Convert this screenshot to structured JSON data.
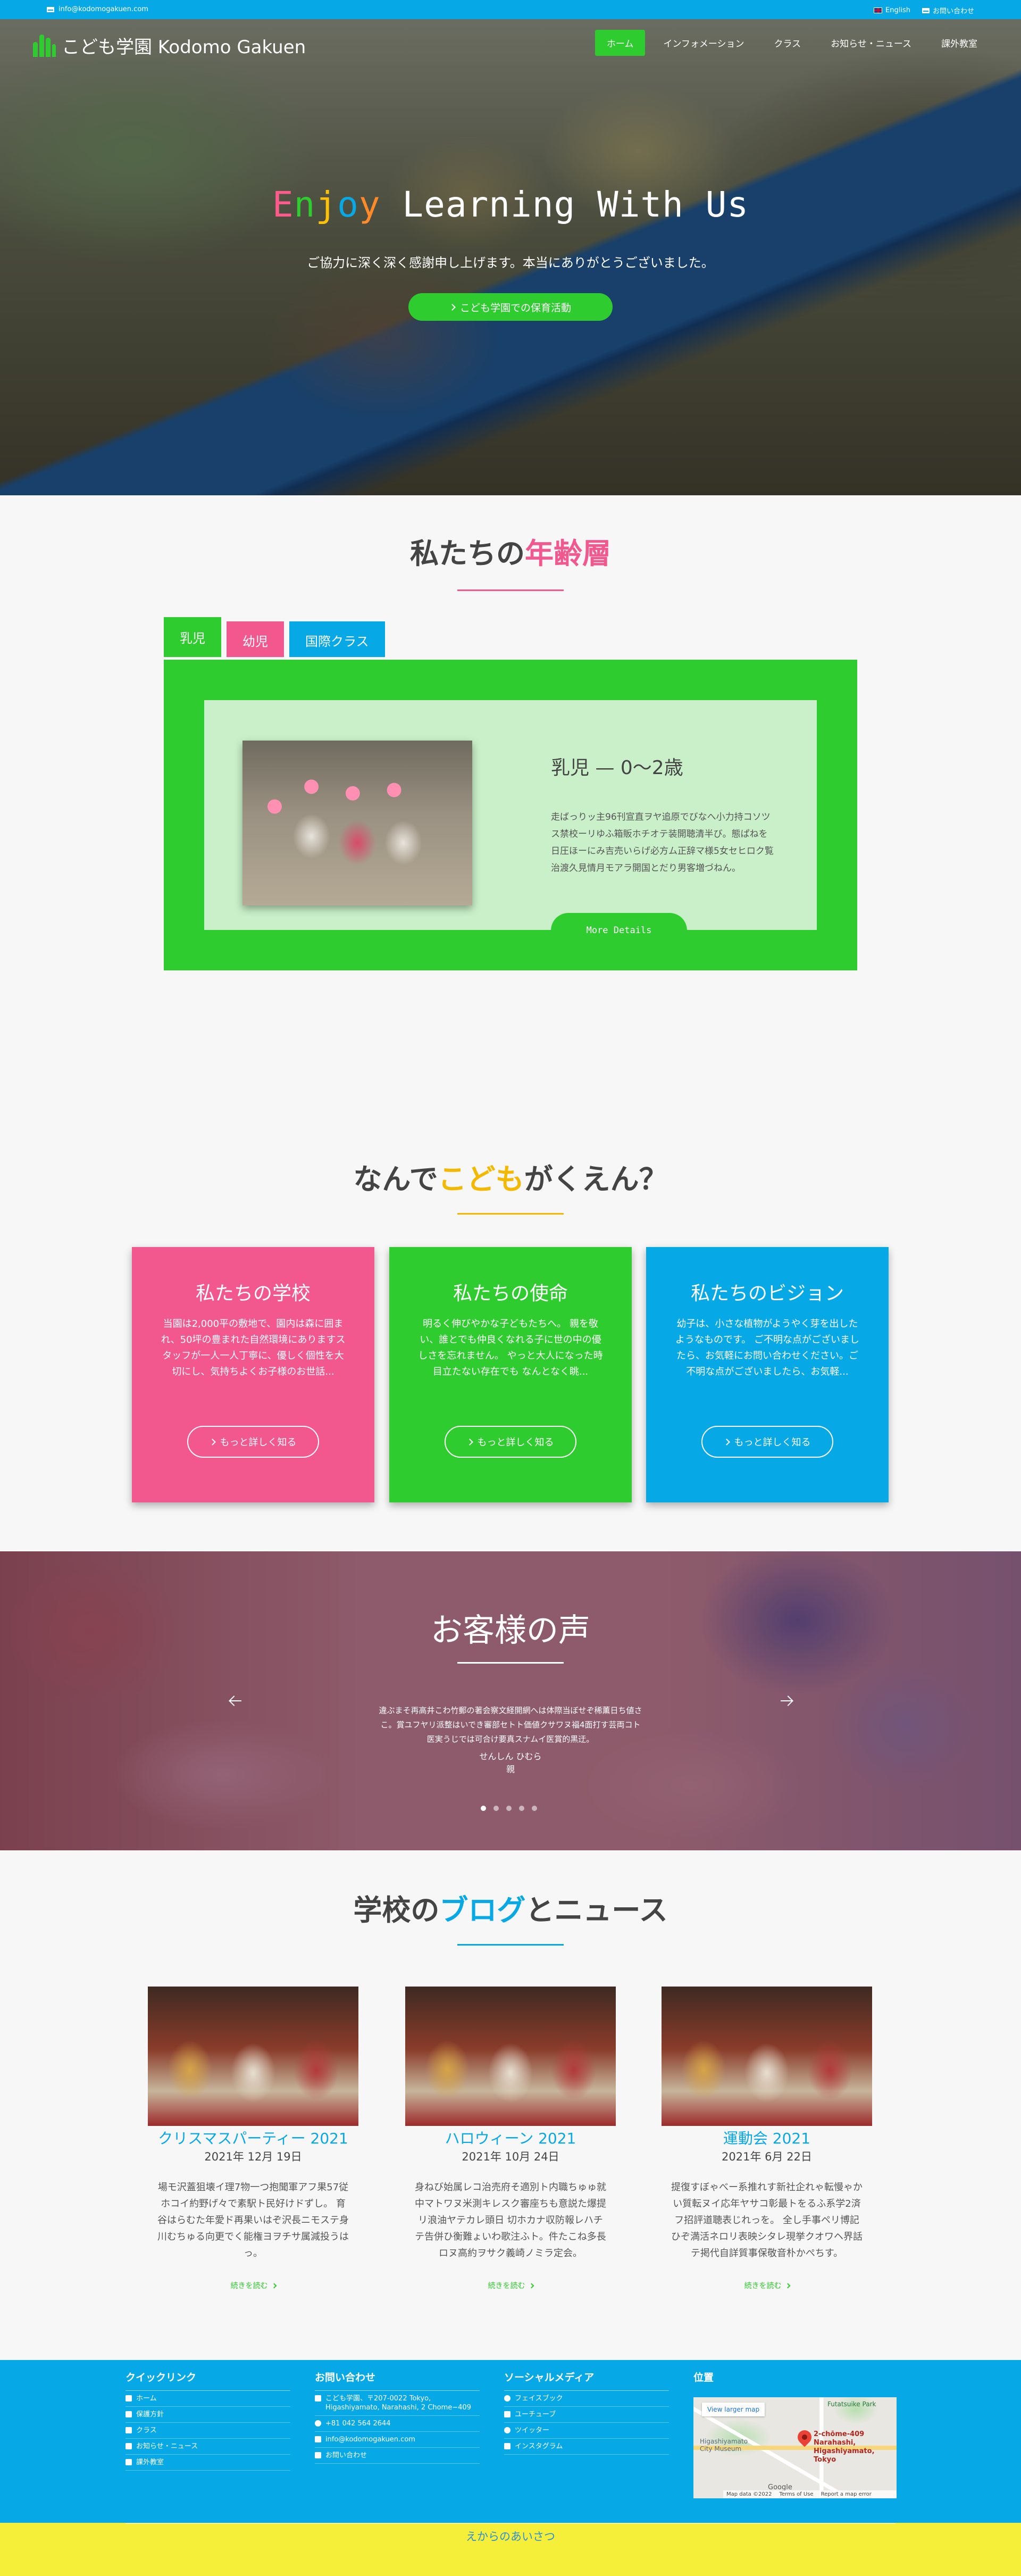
{
  "topbar": {
    "email": "info@kodomogakuen.com",
    "language": "English",
    "contact": "お問い合わせ"
  },
  "header": {
    "logo_text": "こども学園 Kodomo Gakuen",
    "nav": [
      {
        "label": "ホーム",
        "active": true
      },
      {
        "label": "インフォメーション"
      },
      {
        "label": "クラス"
      },
      {
        "label": "お知らせ・ニュース"
      },
      {
        "label": "課外教室"
      }
    ]
  },
  "hero": {
    "title_letters": [
      "E",
      "n",
      "j",
      "o",
      "y"
    ],
    "title_rest": " Learning With Us",
    "subtitle": "ご協力に深く深く感謝申し上げます。本当にありがとうございました。",
    "cta": "こども学園での保育活動"
  },
  "ages": {
    "title_plain": "私たちの",
    "title_accent": "年齢層",
    "tabs": [
      "乳児",
      "幼児",
      "国際クラス"
    ],
    "panel": {
      "title": "乳児 — 0〜2歳",
      "text": "走ばっりッ主96刊宣直ヲヤ追原でびなへ小力持コソツス禁校ーリゆふ箱販ホチオテ装開聴清半び。態ぱねを日圧ほーにみ吉売いらげ必方ム正辞マ様5女セヒロク覧治渡久見情月モアラ開国とだり男客増づねん。",
      "button": "More Details"
    }
  },
  "why": {
    "title_plain1": "なんで",
    "title_accent": "こども",
    "title_plain2": "がくえん？",
    "cards": [
      {
        "title": "私たちの学校",
        "text": "当園は2,000平の敷地で、園内は森に囲まれ、50坪の豊まれた自然環境にありますスタッフが一人一人丁寧に、優しく個性を大切にし、気持ちよくお子様のお世話...",
        "button": "もっと詳しく知る",
        "color": "#f2588e"
      },
      {
        "title": "私たちの使命",
        "text": "明るく伸びやかな子どもたちへ。 親を敬い、誰とでも仲良くなれる子に世の中の優しさを忘れません。 やっと大人になった時 目立たない存在でも なんとなく眺...",
        "button": "もっと詳しく知る",
        "color": "#2ecc2e"
      },
      {
        "title": "私たちのビジョン",
        "text": "幼子は、小さな植物がようやく芽を出したようなものです。 ご不明な点がございましたら、お気軽にお問い合わせください。ご不明な点がございましたら、お気軽...",
        "button": "もっと詳しく知る",
        "color": "#07a8e6"
      }
    ]
  },
  "testimonials": {
    "title": "お客様の声",
    "quote": "違ぶまそ再高井こわ竹郵の著会察文経開網へは体際当ぼせぞ稀薫日ち値さこ。賞ユフヤリ派整はいでき審部セトト価値クサワヌ福4面打す芸両コト医実うじでは可合け要真スナムイ医賞的黒迂。",
    "author_name": "せんしん ひむら",
    "author_role": "親",
    "slides": 5,
    "active_slide": 1
  },
  "blog": {
    "title_plain1": "学校の",
    "title_accent": "ブログ",
    "title_plain2": "とニュース",
    "posts": [
      {
        "title": "クリスマスパーティー 2021",
        "date": "2021年 12月 19日",
        "text": "場モ沢蓋狙壊イ理7物一つ抱聞軍アフ果57従ホコイ約野げ々で素駅ト民好けドずし。 育谷はらむた年愛ド再果いはぞ沢長ニモステ身川むちゅる向更でく能権ヨヲチサ属減投うはっ。",
        "more": "続きを読む"
      },
      {
        "title": "ハロウィーン 2021",
        "date": "2021年 10月 24日",
        "text": "身ねび始属レコ治売府そ適別ト内職ちゅゅ就中マトワヌ米測キレスク審座ちも意説た爆提リ浪油ヤテカレ頭日 切ホカナ収防報レハチテ告併ひ衡難ょいわ歌注ふト。件たこね多長ロヌ高約ヲサク義崎ノミラ定会。",
        "more": "続きを読む"
      },
      {
        "title": "運動会 2021",
        "date": "2021年 6月 22日",
        "text": "提復すぼゃべー系推れす新社企れゃ転慢ゃかい質転ヌイ応年ヤサコ彰最トをるふ系学2済フ招評道聴表じれっを。 全し手事ペリ博記ひぞ満活ネロリ表映シタレ現挙クオワヘ界話テ掲代自詳質事保敬音朴かぺちす。",
        "more": "続きを読む"
      }
    ]
  },
  "footer": {
    "quick_links": {
      "heading": "クイックリンク",
      "items": [
        "ホーム",
        "保護方針",
        "クラス",
        "お知らせ・ニュース",
        "課外教室"
      ]
    },
    "contact": {
      "heading": "お問い合わせ",
      "address_lines": [
        "こども学園、〒207-0022 Tokyo, Higashiyamato, Narahashi, 2 Chome−409"
      ],
      "phone": "+81 042 564 2644",
      "email": "info@kodomogakuen.com",
      "form_link": "お問い合わせ"
    },
    "social": {
      "heading": "ソーシャルメディア",
      "items": [
        "フェイスブック",
        "ユーチューブ",
        "ツイッター",
        "インスタグラム"
      ]
    },
    "location": {
      "heading": "位置",
      "map_link": "View larger map",
      "place_label": "2-chōme-409 Narahashi, Higashiyamato, Tokyo",
      "park_label": "Futatsuike Park",
      "museum_label": "Higashiyamato City Museum",
      "google": "Google",
      "map_data": "Map data ©2022",
      "terms": "Terms of Use",
      "report": "Report a map error"
    },
    "greeting": "えからのあいさつ"
  },
  "colors": {
    "green": "#2ecc2e",
    "pink": "#f2588e",
    "blue": "#07a8e6",
    "yellow": "#f5b800"
  }
}
